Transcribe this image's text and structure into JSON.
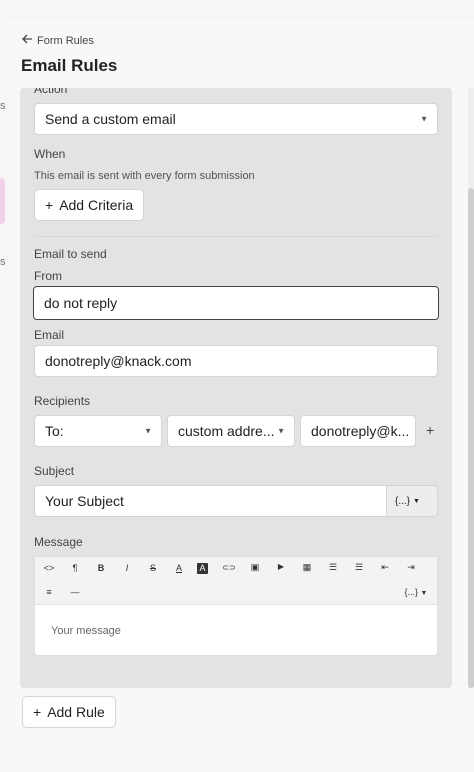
{
  "sidebar_fragments": [
    "s",
    "s"
  ],
  "header": {
    "back_label": "Form Rules",
    "title": "Email Rules"
  },
  "action": {
    "label": "Action",
    "value": "Send a custom email"
  },
  "when": {
    "label": "When",
    "description": "This email is sent with every form submission",
    "add_criteria": "Add Criteria"
  },
  "email_to_send": {
    "section_label": "Email to send",
    "from_label": "From",
    "from_value": "do not reply",
    "email_label": "Email",
    "email_value": "donotreply@knack.com"
  },
  "recipients": {
    "label": "Recipients",
    "type_value": "To:",
    "source_value": "custom addre...",
    "address_value": "donotreply@k..."
  },
  "subject": {
    "label": "Subject",
    "value": "Your Subject",
    "field_insert": "{...}"
  },
  "message": {
    "label": "Message",
    "placeholder": "Your message",
    "toolbar_row1": [
      "<>",
      "¶",
      "B",
      "I",
      "S",
      "A",
      "A",
      "⊂⊃",
      "▣",
      "▶",
      "▦",
      "☰",
      "☰",
      "⇤",
      "⇥"
    ],
    "toolbar_row2": [
      "≡",
      "—"
    ],
    "field_insert": "{...}"
  },
  "footer": {
    "add_rule": "Add Rule"
  }
}
